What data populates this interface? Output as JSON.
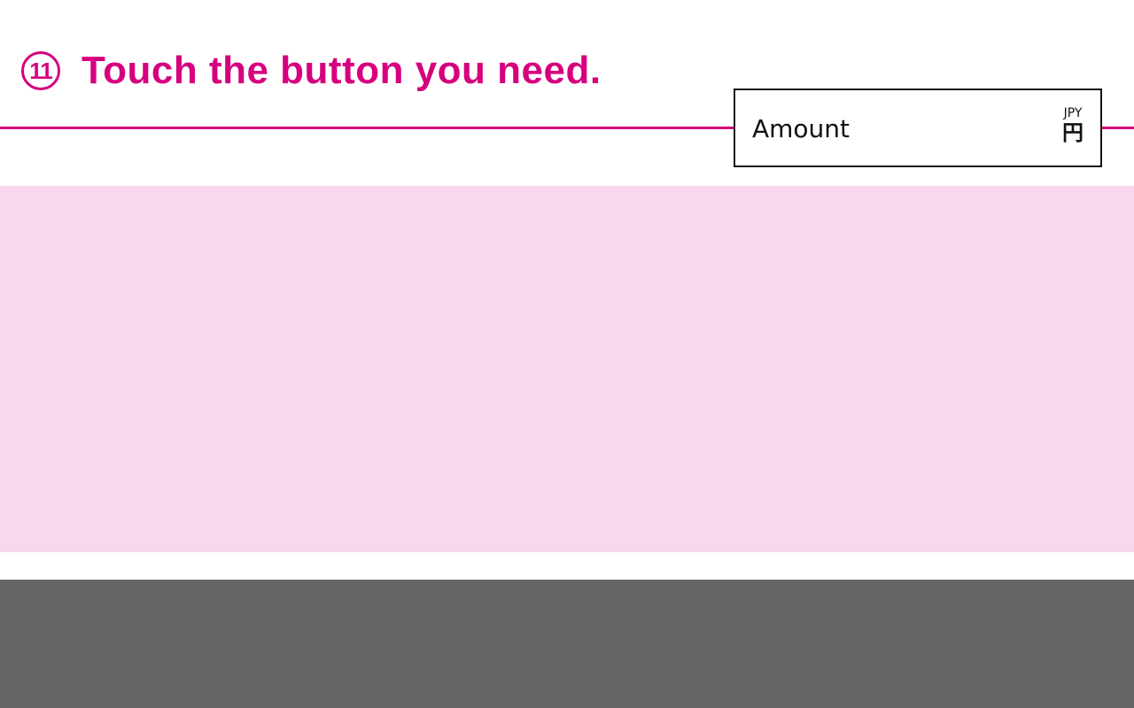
{
  "header": {
    "step_number": "11",
    "instruction": "Touch the button you need."
  },
  "amount_display": {
    "label": "Amount",
    "currency_code": "JPY",
    "currency_symbol": "円"
  },
  "colors": {
    "accent": "#d6007f",
    "panel": "#f7d8ec",
    "footer": "#666666"
  }
}
